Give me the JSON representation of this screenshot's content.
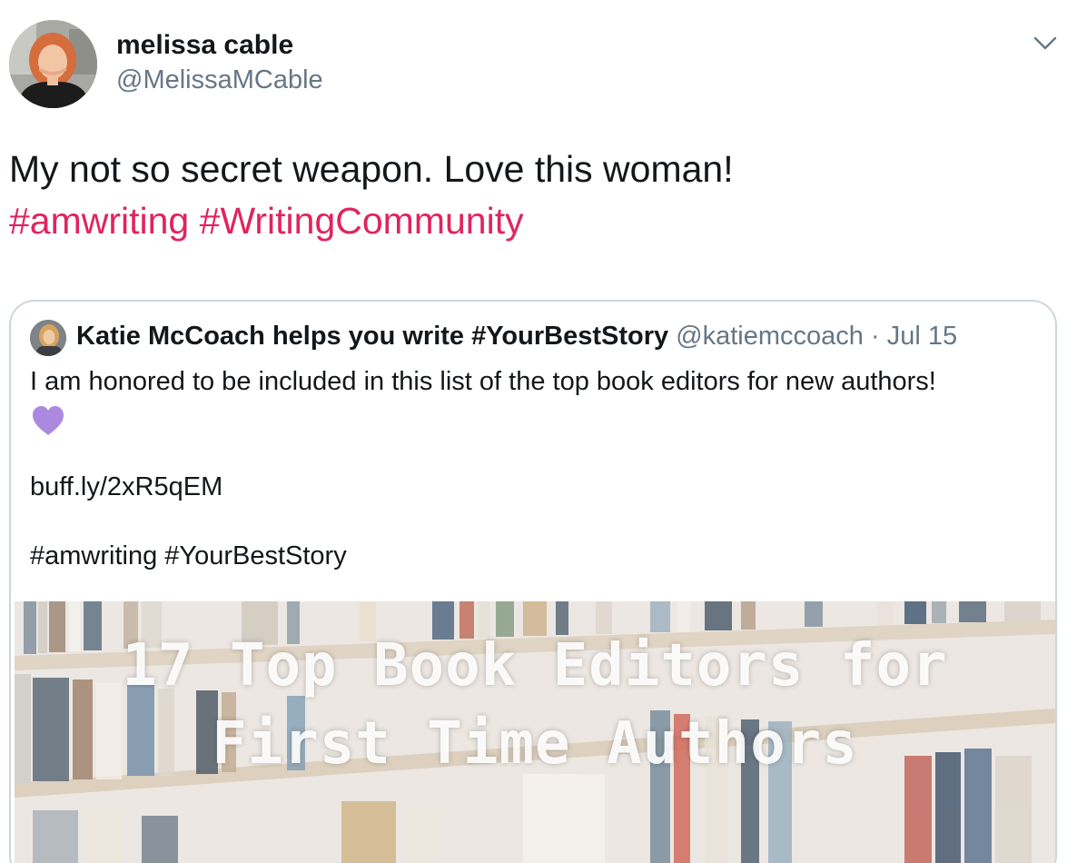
{
  "tweet": {
    "author_name": "melissa cable",
    "author_handle": "@MelissaMCable",
    "text_line1": "My not so secret weapon. Love this woman!",
    "hashtag1": "#amwriting",
    "hashtag2": "#WritingCommunity"
  },
  "quote": {
    "name": "Katie McCoach helps you write #YourBestStory",
    "handle": "@katiemccoach",
    "separator": " · ",
    "date": "Jul 15",
    "text": "I am honored to be included in this list of the top book editors for new authors!",
    "link": "buff.ly/2xR5qEM",
    "tags": "#amwriting #YourBestStory",
    "image_title_line1": "17 Top Book Editors for",
    "image_title_line2": "First Time Authors"
  },
  "colors": {
    "hashtag": "#e0245e",
    "muted": "#657786",
    "heart": "#ab89e0",
    "border": "#ccd6dd"
  },
  "icons": {
    "caret": "chevron-down-icon",
    "heart": "purple-heart-icon"
  }
}
